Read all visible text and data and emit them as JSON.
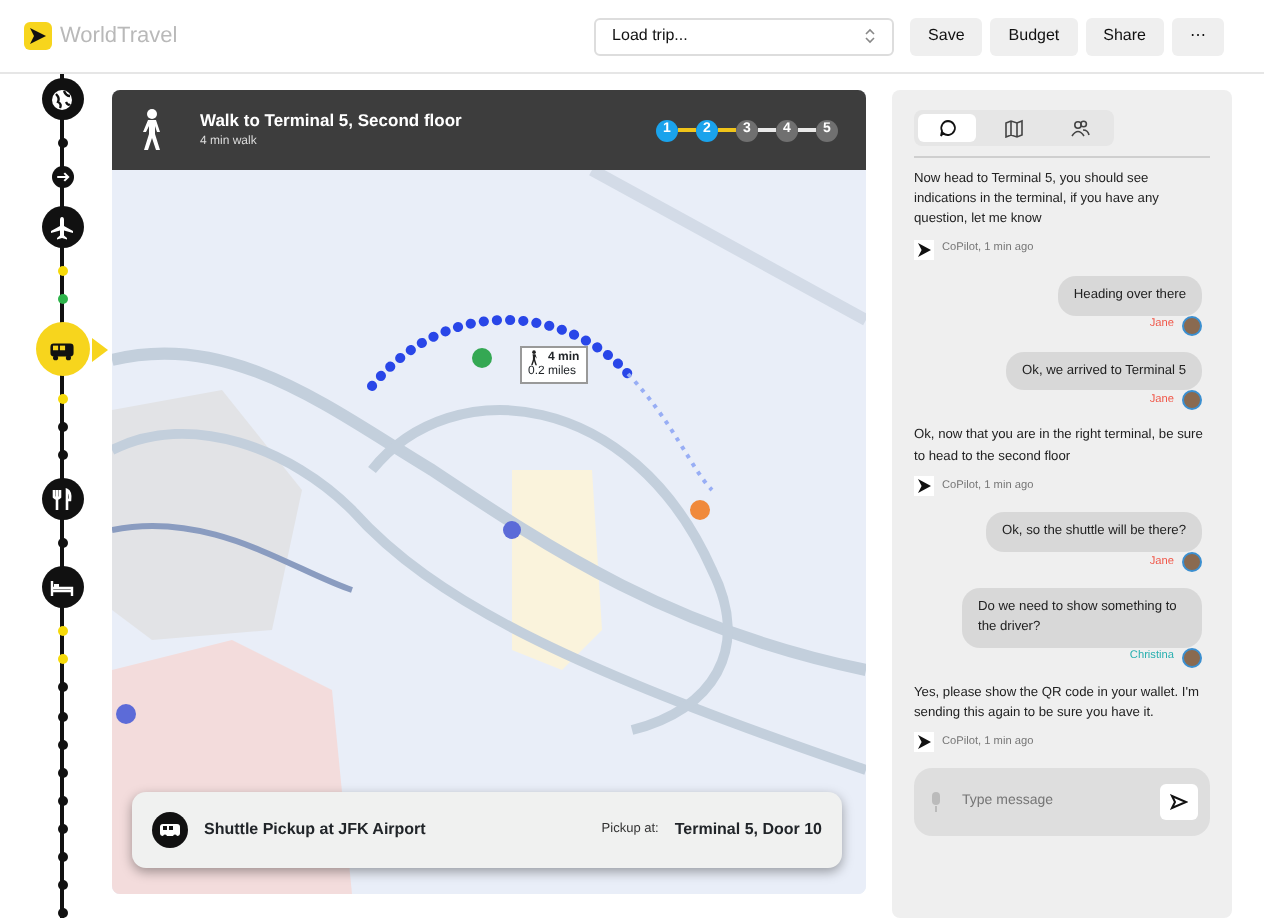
{
  "header": {
    "app_name": "WorldTravel",
    "trip_select": {
      "value": "Load trip..."
    },
    "buttons": [
      "Save",
      "Budget",
      "Share",
      "⋯"
    ]
  },
  "timeline": {
    "nodes": [
      {
        "kind": "globe",
        "selected": false
      },
      {
        "kind": "dot",
        "color": "#111111"
      },
      {
        "kind": "arrow",
        "selected": false
      },
      {
        "kind": "plane",
        "selected": false
      },
      {
        "kind": "dot",
        "color": "#f5d90a"
      },
      {
        "kind": "dot",
        "color": "#2db34a"
      },
      {
        "kind": "van",
        "selected": true
      },
      {
        "kind": "dot",
        "color": "#f5d90a"
      },
      {
        "kind": "dot",
        "color": "#111111"
      },
      {
        "kind": "dot",
        "color": "#111111"
      },
      {
        "kind": "fork-knife",
        "selected": false
      },
      {
        "kind": "dot",
        "color": "#111111"
      },
      {
        "kind": "bed",
        "selected": false
      },
      {
        "kind": "dot",
        "color": "#f5d90a"
      },
      {
        "kind": "dot",
        "color": "#f5d90a"
      },
      {
        "kind": "dot",
        "color": "#111111"
      },
      {
        "kind": "dot",
        "color": "#111111"
      },
      {
        "kind": "dot",
        "color": "#111111"
      },
      {
        "kind": "dot",
        "color": "#111111"
      },
      {
        "kind": "dot",
        "color": "#111111"
      },
      {
        "kind": "dot",
        "color": "#111111"
      },
      {
        "kind": "dot",
        "color": "#111111"
      },
      {
        "kind": "dot",
        "color": "#111111"
      },
      {
        "kind": "dot",
        "color": "#111111"
      }
    ]
  },
  "route": {
    "title": "Walk to Terminal 5, Second floor",
    "subtitle": "4 min walk",
    "steps": [
      {
        "label": "1",
        "done": true
      },
      {
        "label": "2",
        "done": true
      },
      {
        "label": "3",
        "done": false
      },
      {
        "label": "4",
        "done": false
      },
      {
        "label": "5",
        "done": false
      }
    ],
    "callout": {
      "time": "4 min",
      "distance": "0.2 miles"
    },
    "pickup": {
      "title": "Shuttle Pickup at JFK Airport",
      "label": "Pickup at:",
      "location": "Terminal 5, Door 10"
    }
  },
  "chat": {
    "tabs": [
      {
        "kind": "chat",
        "selected": true
      },
      {
        "kind": "map",
        "selected": false
      },
      {
        "kind": "people",
        "selected": false
      }
    ],
    "messages": [
      {
        "kind": "bot",
        "text": "Now head to Terminal 5, you should see indications in the terminal, if you have any question, let me know",
        "meta": "CoPilot, 1 min ago"
      },
      {
        "kind": "user",
        "text": "Heading over there",
        "author": "Jane",
        "color": "#f0584a"
      },
      {
        "kind": "user",
        "text": "Ok, we arrived to Terminal 5",
        "author": "Jane",
        "color": "#f0584a"
      },
      {
        "kind": "bot",
        "text": "Ok, now that you are in the right terminal, be sure to head to the second floor",
        "meta": "CoPilot, 1 min ago"
      },
      {
        "kind": "user",
        "text": "Ok, so the shuttle will be there?",
        "author": "Jane",
        "color": "#f0584a"
      },
      {
        "kind": "user",
        "text": "Do we need to show something to the driver?",
        "author": "Christina",
        "color": "#2ab0b0"
      },
      {
        "kind": "bot",
        "text": "Yes, please show the QR code in your wallet. I'm sending this again to be sure you have it.",
        "meta": "CoPilot, 1 min ago"
      }
    ],
    "input": {
      "placeholder": "Type message"
    }
  }
}
